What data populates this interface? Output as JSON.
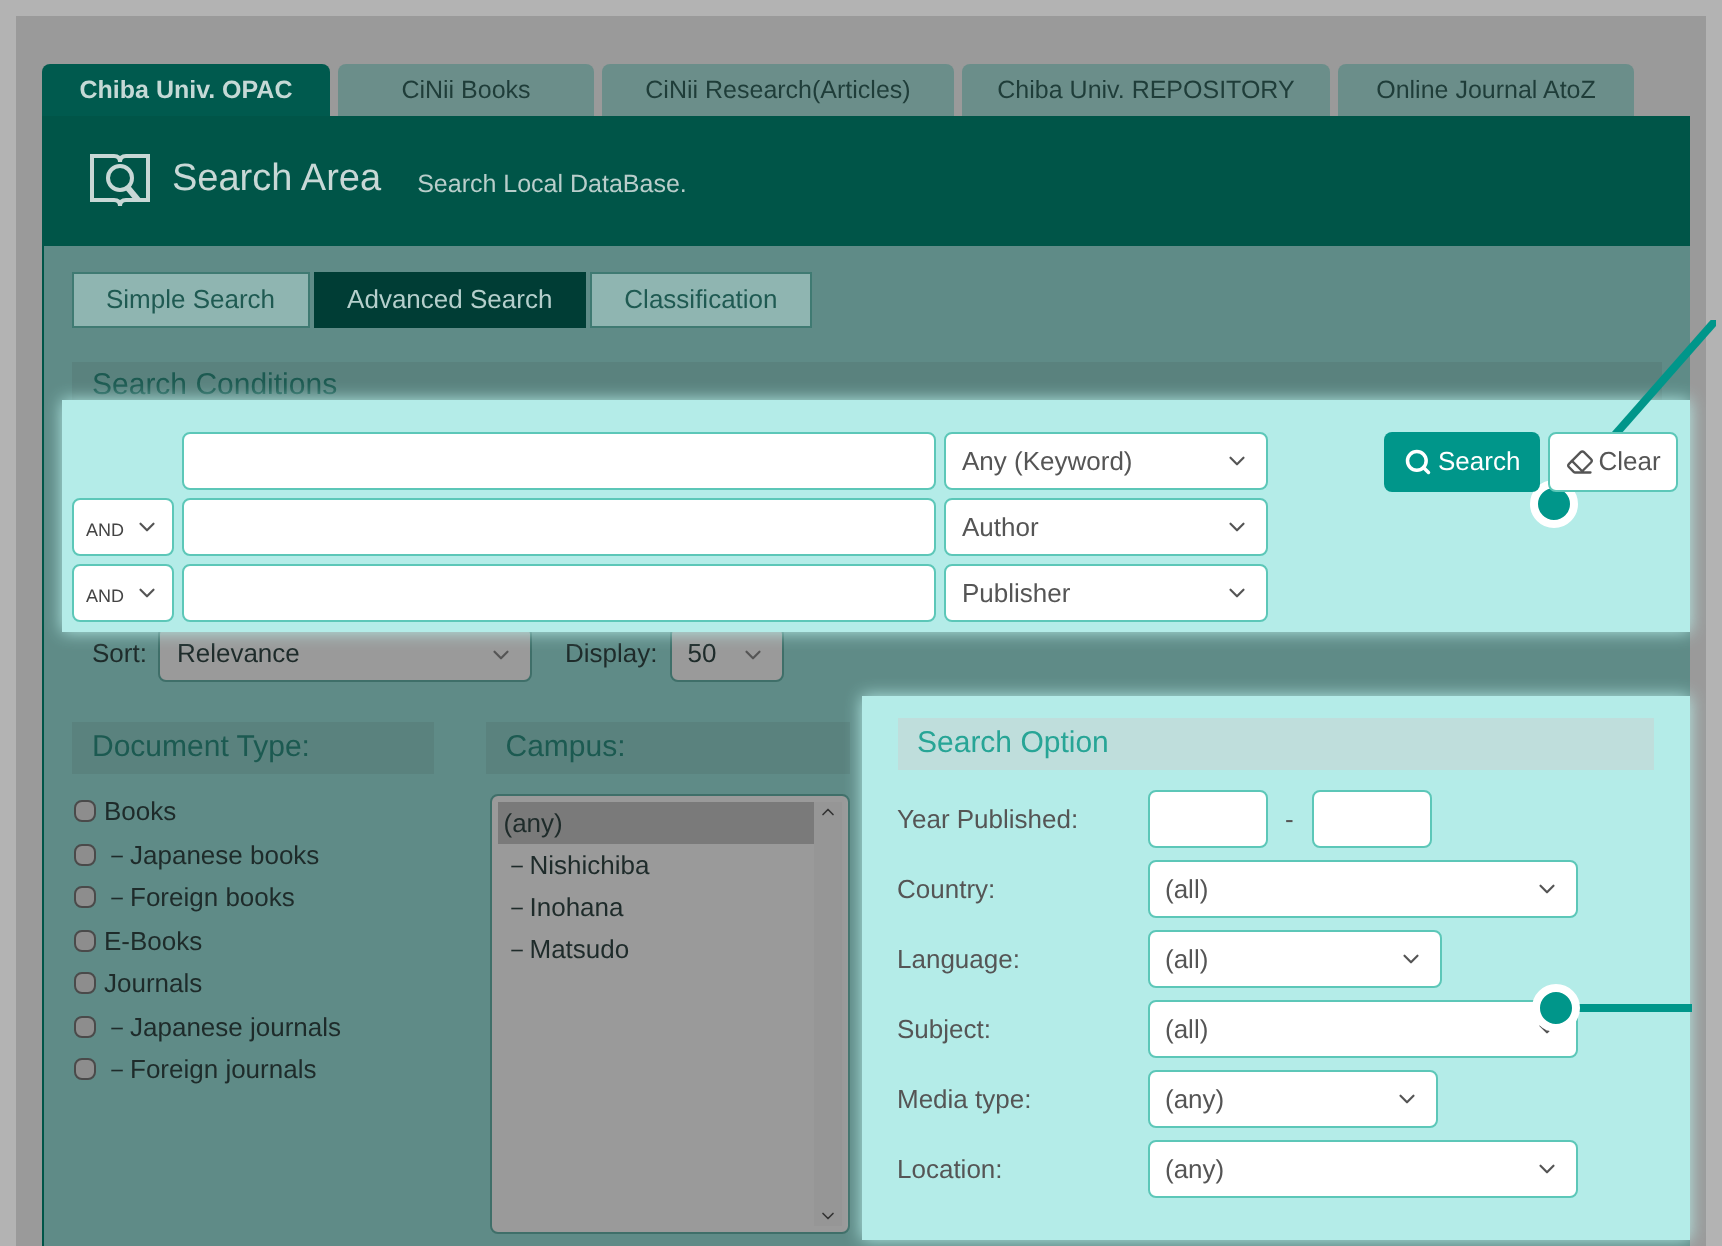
{
  "tabs": [
    {
      "label": "Chiba Univ. OPAC",
      "selected": true
    },
    {
      "label": "CiNii Books",
      "selected": false
    },
    {
      "label": "CiNii Research(Articles)",
      "selected": false
    },
    {
      "label": "Chiba Univ. REPOSITORY",
      "selected": false
    },
    {
      "label": "Online Journal AtoZ",
      "selected": false
    }
  ],
  "header": {
    "title": "Search Area",
    "subtitle": "Search Local DataBase."
  },
  "search_modes": [
    {
      "label": "Simple Search",
      "selected": false
    },
    {
      "label": "Advanced Search",
      "selected": true
    },
    {
      "label": "Classification",
      "selected": false
    }
  ],
  "conditions": {
    "title": "Search Conditions",
    "rows": [
      {
        "field": "Any (Keyword)"
      },
      {
        "operator": "AND",
        "field": "Author"
      },
      {
        "operator": "AND",
        "field": "Publisher"
      }
    ],
    "search_button": "Search",
    "clear_button": "Clear"
  },
  "sort": {
    "label": "Sort:",
    "value": "Relevance"
  },
  "display": {
    "label": "Display:",
    "value": "50"
  },
  "document_type": {
    "title": "Document Type:",
    "items": [
      {
        "label": "Books",
        "checked": false,
        "children": [
          {
            "label": "－Japanese books",
            "checked": false
          },
          {
            "label": "－Foreign books",
            "checked": false
          }
        ]
      },
      {
        "label": "E-Books",
        "checked": false
      },
      {
        "label": "Journals",
        "checked": false,
        "children": [
          {
            "label": "－Japanese journals",
            "checked": false
          },
          {
            "label": "－Foreign journals",
            "checked": false
          }
        ]
      }
    ]
  },
  "campus": {
    "title": "Campus:",
    "options": [
      {
        "label": "(any)",
        "selected": true
      },
      {
        "label": "－Nishichiba",
        "selected": false
      },
      {
        "label": "－Inohana",
        "selected": false
      },
      {
        "label": "－Matsudo",
        "selected": false
      }
    ]
  },
  "search_option": {
    "title": "Search Option",
    "year": {
      "label": "Year Published:",
      "separator": "-"
    },
    "fields": [
      {
        "label": "Country:",
        "value": "(all)"
      },
      {
        "label": "Language:",
        "value": "(all)"
      },
      {
        "label": "Subject:",
        "value": "(all)"
      },
      {
        "label": "Media type:",
        "value": "(any)"
      },
      {
        "label": "Location:",
        "value": "(any)"
      }
    ]
  }
}
